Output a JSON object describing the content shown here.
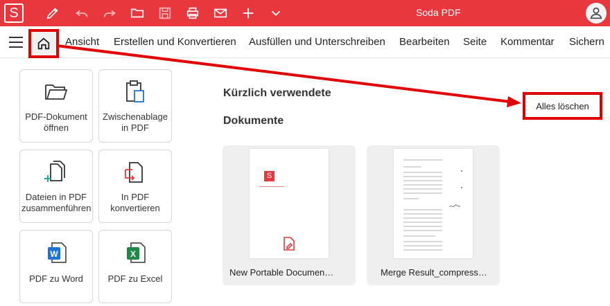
{
  "app": {
    "logo_letter": "S",
    "title": "Soda PDF"
  },
  "toolbar": {
    "icons": [
      "pen-icon",
      "undo-icon",
      "redo-icon",
      "folder-icon",
      "save-icon",
      "print-icon",
      "mail-icon",
      "plus-icon",
      "chevron-down-icon"
    ]
  },
  "menu": {
    "items": [
      "Ansicht",
      "Erstellen und Konvertieren",
      "Ausfüllen und Unterschreiben",
      "Bearbeiten",
      "Seite",
      "Kommentar",
      "Sichern"
    ]
  },
  "tiles": [
    {
      "label": "PDF-Dokument öffnen",
      "icon": "open-folder-icon"
    },
    {
      "label": "Zwischenablage in PDF",
      "icon": "clipboard-icon"
    },
    {
      "label": "Dateien in PDF zusammenführen",
      "icon": "merge-files-icon"
    },
    {
      "label": "In PDF konvertieren",
      "icon": "convert-icon"
    },
    {
      "label": "PDF zu Word",
      "icon": "word-icon",
      "badge": "W"
    },
    {
      "label": "PDF zu Excel",
      "icon": "excel-icon",
      "badge": "X"
    }
  ],
  "main": {
    "recent_title": "Kürzlich verwendete",
    "documents_title": "Dokumente",
    "clear_label": "Alles löschen"
  },
  "documents": [
    {
      "name": "New Portable Documen…",
      "thumb_logo": "S"
    },
    {
      "name": "Merge Result_compress…"
    }
  ],
  "colors": {
    "brand": "#e8373d",
    "highlight": "#e00000",
    "word": "#1e73d8",
    "excel": "#1e8a45"
  }
}
